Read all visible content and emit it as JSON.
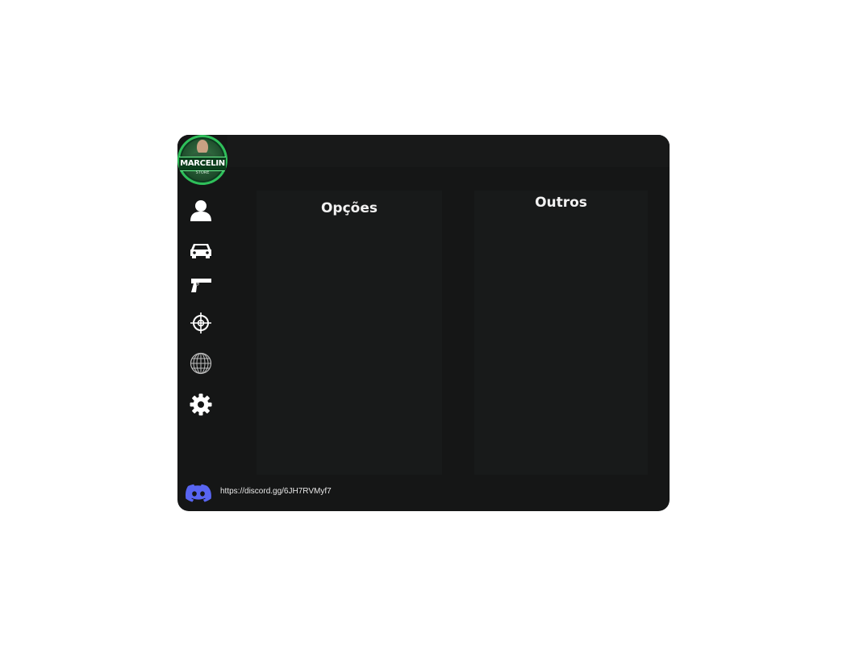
{
  "brand": {
    "logo_text": "MARCELIN",
    "logo_subtext": "STORE",
    "accent_color": "#2fbf5a"
  },
  "sidebar": {
    "items": [
      {
        "icon": "user-icon"
      },
      {
        "icon": "car-icon"
      },
      {
        "icon": "pistol-icon"
      },
      {
        "icon": "crosshair-icon"
      },
      {
        "icon": "globe-icon"
      },
      {
        "icon": "gear-icon"
      }
    ]
  },
  "panels": {
    "options_title": "Opções",
    "others_title": "Outros"
  },
  "footer": {
    "discord_icon": "discord-icon",
    "discord_color": "#5865f2",
    "discord_link": "https://discord.gg/6JH7RVMyf7"
  }
}
